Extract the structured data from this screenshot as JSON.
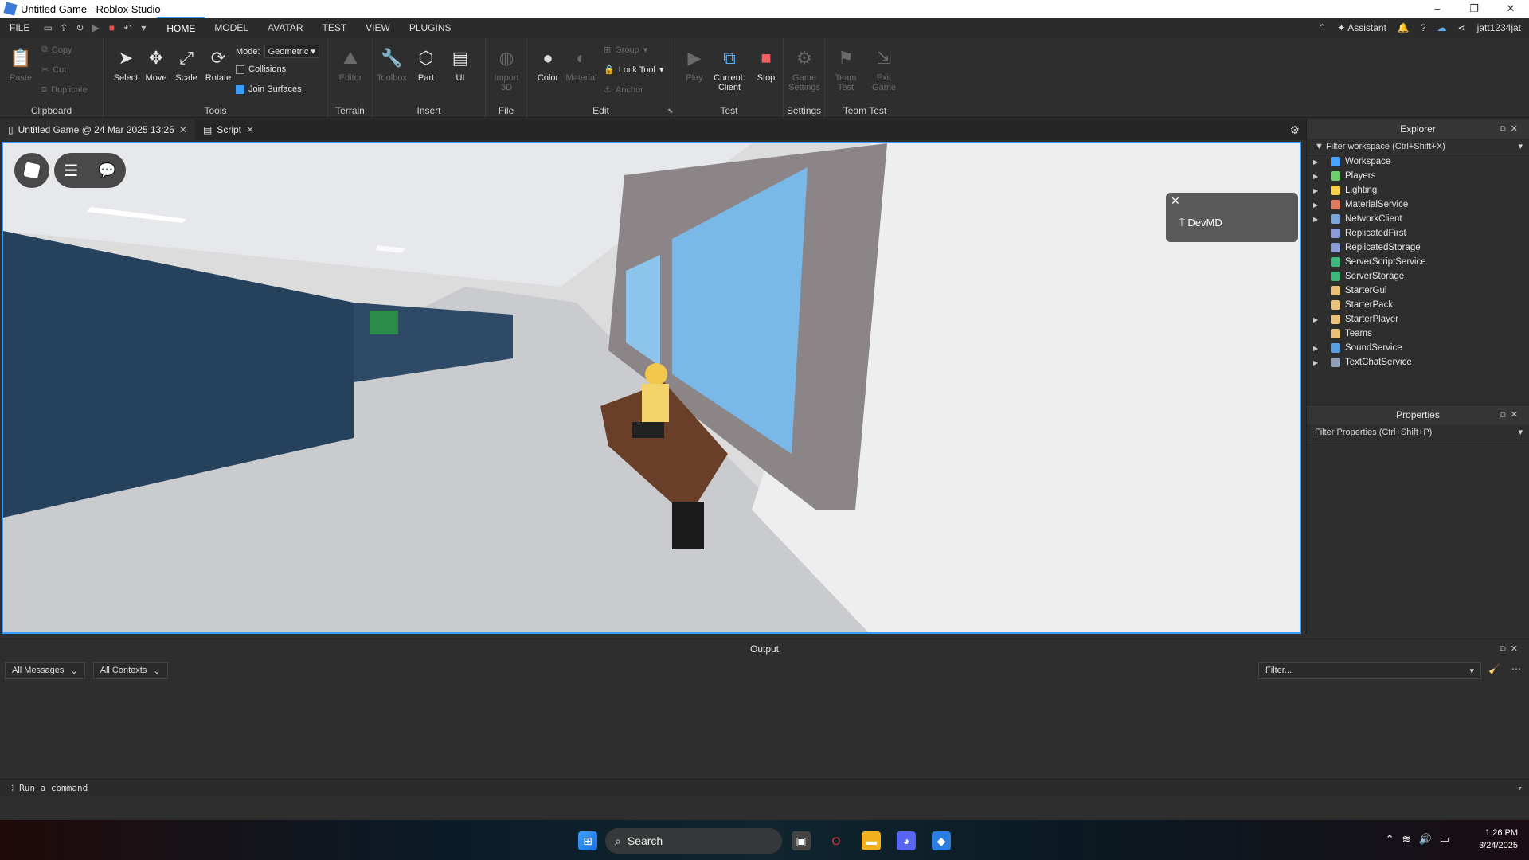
{
  "window": {
    "title": "Untitled Game - Roblox Studio",
    "minimize": "–",
    "maximize": "❐",
    "close": "✕"
  },
  "menubar": {
    "file": "FILE",
    "tabs": [
      "HOME",
      "MODEL",
      "AVATAR",
      "TEST",
      "VIEW",
      "PLUGINS"
    ],
    "assistant": "Assistant",
    "user": "jatt1234jat"
  },
  "ribbon": {
    "clipboard": {
      "label": "Clipboard",
      "paste": "Paste",
      "copy": "Copy",
      "cut": "Cut",
      "duplicate": "Duplicate"
    },
    "tools": {
      "label": "Tools",
      "select": "Select",
      "move": "Move",
      "scale": "Scale",
      "rotate": "Rotate",
      "mode_label": "Mode:",
      "mode_value": "Geometric",
      "collisions": "Collisions",
      "join_surfaces": "Join Surfaces",
      "collisions_checked": false,
      "join_surfaces_checked": true
    },
    "terrain": {
      "label": "Terrain",
      "editor": "Editor"
    },
    "insert": {
      "label": "Insert",
      "toolbox": "Toolbox",
      "part": "Part",
      "ui": "UI"
    },
    "file": {
      "label": "File",
      "import3d": "Import 3D"
    },
    "edit": {
      "label": "Edit",
      "color": "Color",
      "material": "Material",
      "group": "Group",
      "lock_tool": "Lock Tool",
      "anchor": "Anchor"
    },
    "test": {
      "label": "Test",
      "play": "Play",
      "current_client": "Current: Client",
      "stop": "Stop"
    },
    "settings": {
      "label": "Settings",
      "game_settings": "Game Settings"
    },
    "team_test": {
      "label": "Team Test",
      "team_test": "Team Test",
      "exit_game": "Exit Game"
    }
  },
  "doc_tabs": [
    {
      "label": "Untitled Game @ 24 Mar 2025 13:25"
    },
    {
      "label": "Script"
    }
  ],
  "viewport": {
    "overlay_label": "DevMD"
  },
  "explorer": {
    "title": "Explorer",
    "filter": "Filter workspace (Ctrl+Shift+X)",
    "items": [
      {
        "name": "Workspace",
        "expandable": true,
        "color": "#4aa3ff"
      },
      {
        "name": "Players",
        "expandable": true,
        "color": "#6fcf6f"
      },
      {
        "name": "Lighting",
        "expandable": true,
        "color": "#f5d04a"
      },
      {
        "name": "MaterialService",
        "expandable": true,
        "color": "#e07a5f"
      },
      {
        "name": "NetworkClient",
        "expandable": true,
        "color": "#7aa6d8"
      },
      {
        "name": "ReplicatedFirst",
        "expandable": false,
        "color": "#8a9bd6"
      },
      {
        "name": "ReplicatedStorage",
        "expandable": false,
        "color": "#8a9bd6"
      },
      {
        "name": "ServerScriptService",
        "expandable": false,
        "color": "#3fb67a"
      },
      {
        "name": "ServerStorage",
        "expandable": false,
        "color": "#3fb67a"
      },
      {
        "name": "StarterGui",
        "expandable": false,
        "color": "#e8c27a"
      },
      {
        "name": "StarterPack",
        "expandable": false,
        "color": "#e8c27a"
      },
      {
        "name": "StarterPlayer",
        "expandable": true,
        "color": "#e8c27a"
      },
      {
        "name": "Teams",
        "expandable": false,
        "color": "#e8c27a"
      },
      {
        "name": "SoundService",
        "expandable": true,
        "color": "#5aa0e0"
      },
      {
        "name": "TextChatService",
        "expandable": true,
        "color": "#8fa0b8"
      }
    ]
  },
  "properties": {
    "title": "Properties",
    "filter": "Filter Properties (Ctrl+Shift+P)"
  },
  "output": {
    "title": "Output",
    "messages": "All Messages",
    "contexts": "All Contexts",
    "filter": "Filter..."
  },
  "command": {
    "placeholder": "Run a command"
  },
  "taskbar": {
    "search": "Search",
    "time": "1:26 PM",
    "date": "3/24/2025"
  }
}
